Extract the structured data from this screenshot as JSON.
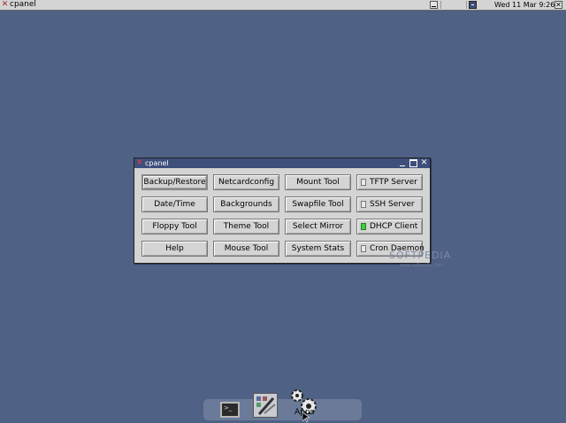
{
  "topbar": {
    "title": "cpanel",
    "clock": "Wed 11 Mar  9:26"
  },
  "window": {
    "title": "cpanel",
    "buttons": [
      "Backup/Restore",
      "Netcardconfig",
      "Mount Tool",
      "Date/Time",
      "Backgrounds",
      "Swapfile Tool",
      "Floppy Tool",
      "Theme Tool",
      "Select Mirror",
      "Help",
      "Mouse Tool",
      "System Stats"
    ],
    "services": [
      {
        "label": "TFTP Server",
        "checked": false
      },
      {
        "label": "SSH Server",
        "checked": false
      },
      {
        "label": "DHCP Client",
        "checked": true
      },
      {
        "label": "Cron Daemon",
        "checked": false
      }
    ],
    "colors": {
      "active_indicator": "#3fcf3f",
      "titlebar": "#3e4f7c",
      "desktop": "#4f6184"
    }
  },
  "watermark": {
    "text": "SOFTPEDIA",
    "url": "www.softpedia.com"
  },
  "dock": {
    "terminal_icon": "terminal-icon",
    "tools_icon": "tools-icon",
    "apps_icon": "gears-icon",
    "apps_label": "Apps"
  }
}
